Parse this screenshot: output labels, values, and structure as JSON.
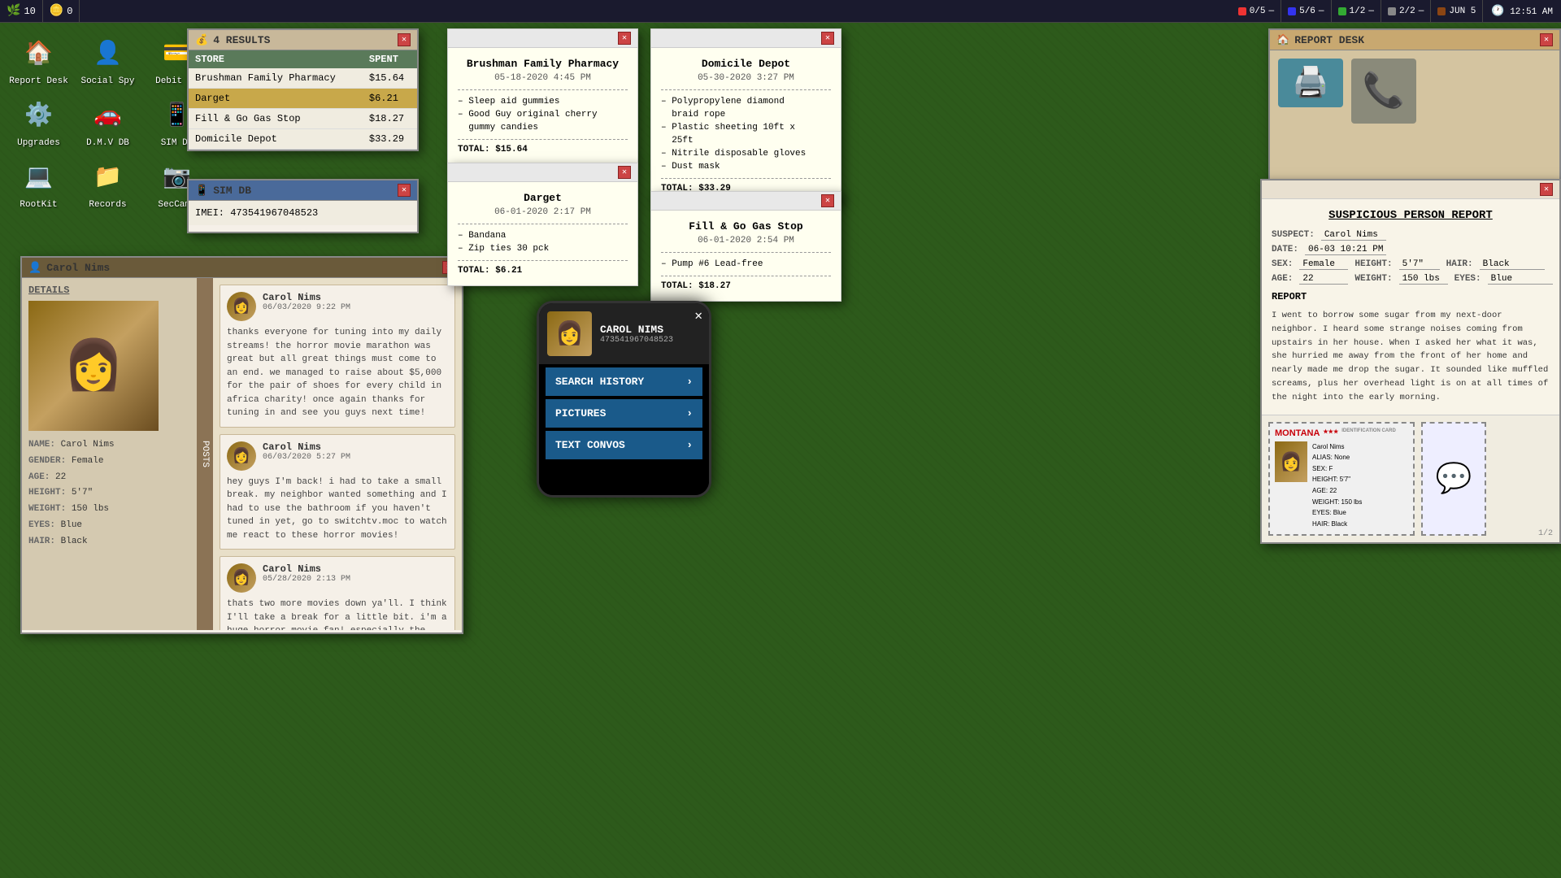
{
  "taskbar": {
    "left_items": [
      {
        "label": "10",
        "icon": "🌿"
      },
      {
        "label": "0",
        "icon": "🪙"
      }
    ],
    "status_items": [
      {
        "color": "red",
        "label": "0/5",
        "dash": "—"
      },
      {
        "color": "blue",
        "label": "5/6",
        "dash": "—"
      },
      {
        "color": "green",
        "label": "1/2",
        "dash": "—"
      },
      {
        "color": "gray",
        "label": "2/2",
        "dash": "—"
      },
      {
        "color": "brown",
        "label": "JUN 5"
      }
    ],
    "time": "12:51 AM"
  },
  "desktop_icons": [
    {
      "id": "report-desk",
      "label": "Report Desk",
      "icon": "🏠"
    },
    {
      "id": "social-spy",
      "label": "Social Spy",
      "icon": "👤"
    },
    {
      "id": "debit-db",
      "label": "Debit DB",
      "icon": "💳"
    },
    {
      "id": "upgrades",
      "label": "Upgrades",
      "icon": "⚙️"
    },
    {
      "id": "dmv-db",
      "label": "D.M.V DB",
      "icon": "🚗"
    },
    {
      "id": "sim-db",
      "label": "SIM DB",
      "icon": "📱"
    },
    {
      "id": "rootkit",
      "label": "RootKit",
      "icon": "💻"
    },
    {
      "id": "records",
      "label": "Records",
      "icon": "📁"
    },
    {
      "id": "sec-cams",
      "label": "SecCams",
      "icon": "📷"
    }
  ],
  "results_window": {
    "title": "4 RESULTS",
    "columns": [
      "STORE",
      "SPENT"
    ],
    "rows": [
      {
        "store": "Brushman Family Pharmacy",
        "spent": "$15.64",
        "highlighted": false
      },
      {
        "store": "Darget",
        "spent": "$6.21",
        "highlighted": true
      },
      {
        "store": "Fill & Go Gas Stop",
        "spent": "$18.27",
        "highlighted": false
      },
      {
        "store": "Domicile Depot",
        "spent": "$33.29",
        "highlighted": false
      }
    ]
  },
  "simdb_window": {
    "title": "SIM DB",
    "imei_label": "IMEI:",
    "imei_value": "473541967048523"
  },
  "carol_window": {
    "title": "Carol Nims",
    "details_label": "DETAILS",
    "posts_tab": "POSTS",
    "photo_placeholder": "👩",
    "fields": [
      {
        "label": "NAME:",
        "value": "Carol Nims"
      },
      {
        "label": "GENDER:",
        "value": "Female"
      },
      {
        "label": "AGE:",
        "value": "22"
      },
      {
        "label": "HEIGHT:",
        "value": "5'7\""
      },
      {
        "label": "WEIGHT:",
        "value": "150 lbs"
      },
      {
        "label": "EYES:",
        "value": "Blue"
      },
      {
        "label": "HAIR:",
        "value": "Black"
      }
    ],
    "posts": [
      {
        "name": "Carol Nims",
        "date": "06/03/2020 9:22 PM",
        "text": "thanks everyone for tuning into my daily streams! the horror movie marathon was great but all great things must come to an end. we managed to raise about $5,000 for the pair of shoes for every child in africa charity! once again thanks for tuning in and see you guys next time!"
      },
      {
        "name": "Carol Nims",
        "date": "06/03/2020 5:27 PM",
        "text": "hey guys I'm back! i had to take a small break. my neighbor wanted something and I had to use the bathroom if you haven't tuned in yet, go to switchtv.moc to watch me react to these horror movies!"
      },
      {
        "name": "Carol Nims",
        "date": "05/28/2020 2:13 PM",
        "text": "thats two more movies down ya'll. I think I'll take a break for a little bit. i'm a huge horror movie fan! especially the ones"
      }
    ]
  },
  "receipts": {
    "brushman": {
      "title": "Brushman Family Pharmacy",
      "date": "05-18-2020 4:45 PM",
      "items": [
        "– Sleep aid gummies",
        "– Good Guy original cherry",
        "  gummy candies"
      ],
      "total_label": "TOTAL:",
      "total_value": "$15.64"
    },
    "domicile": {
      "title": "Domicile Depot",
      "date": "05-30-2020 3:27 PM",
      "items": [
        "– Polypropylene diamond",
        "  braid rope",
        "– Plastic sheeting 10ft x",
        "  25ft",
        "– Nitrile disposable gloves",
        "– Dust mask"
      ],
      "total_label": "TOTAL:",
      "total_value": "$33.29"
    },
    "darget": {
      "title": "Darget",
      "date": "06-01-2020 2:17 PM",
      "items": [
        "– Bandana",
        "– Zip ties 30 pck"
      ],
      "total_label": "TOTAL:",
      "total_value": "$6.21"
    },
    "fillgo": {
      "title": "Fill & Go Gas Stop",
      "date": "06-01-2020 2:54 PM",
      "items": [
        "– Pump #6 Lead-free"
      ],
      "total_label": "TOTAL:",
      "total_value": "$18.27"
    }
  },
  "phone": {
    "profile_icon": "👩",
    "name": "CAROL NIMS",
    "imei": "473541967048523",
    "menu": [
      {
        "label": "SEARCH HISTORY",
        "arrow": "›"
      },
      {
        "label": "PICTURES",
        "arrow": "›"
      },
      {
        "label": "TEXT CONVOS",
        "arrow": "›"
      }
    ]
  },
  "report_desk": {
    "title": "REPORT DESK",
    "printer_icon": "🖨️",
    "phone_icon": "📞"
  },
  "suspicious_report": {
    "title": "SUSPICIOUS PERSON REPORT",
    "suspect_label": "SUSPECT:",
    "suspect_value": "Carol Nims",
    "date_label": "DATE:",
    "date_value": "06-03 10:21 PM",
    "sex_label": "SEX:",
    "sex_value": "Female",
    "height_label": "HEIGHT:",
    "height_value": "5'7\"",
    "hair_label": "HAIR:",
    "hair_value": "Black",
    "age_label": "AGE:",
    "age_value": "22",
    "weight_label": "WEIGHT:",
    "weight_value": "150 lbs",
    "eyes_label": "EYES:",
    "eyes_value": "Blue",
    "report_label": "REPORT",
    "report_text": "I went to borrow some sugar from my next-door neighbor. I heard some strange noises coming from upstairs in her house. When I asked her what it was, she hurried me away from the front of her home and nearly made me drop the sugar. It sounded like muffled screams, plus her overhead light is on at all times of the night into the early morning."
  },
  "id_card": {
    "state": "MONTANA",
    "type": "IDENTIFICATION CARD",
    "name": "Carol Nims",
    "alias": "ALIAS: None",
    "sex": "SEX: F",
    "height": "HEIGHT: 5'7\"",
    "age": "AGE: 22",
    "weight": "WEIGHT: 150 lbs",
    "eyes": "EYES: Blue",
    "hair": "HAIR: Black",
    "photo_icon": "👩",
    "page_counter": "1/2"
  }
}
